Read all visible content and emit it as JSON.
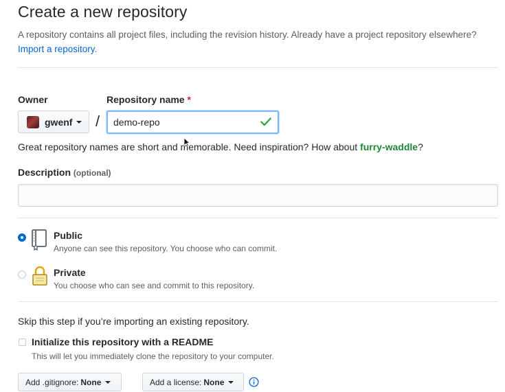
{
  "page": {
    "title": "Create a new repository",
    "intro_text": "A repository contains all project files, including the revision history. Already have a project repository elsewhere?",
    "import_link": "Import a repository",
    "intro_period": "."
  },
  "owner": {
    "label": "Owner",
    "value": "gwenf"
  },
  "repo_name": {
    "label": "Repository name",
    "required_mark": "*",
    "value": "demo-repo",
    "slash": "/"
  },
  "hint": {
    "text": "Great repository names are short and memorable. Need inspiration? How about",
    "suggestion": "furry-waddle",
    "suffix": "?"
  },
  "description": {
    "label": "Description",
    "optional": "(optional)",
    "value": ""
  },
  "visibility": {
    "selected": "public",
    "public": {
      "title": "Public",
      "note": "Anyone can see this repository. You choose who can commit."
    },
    "private": {
      "title": "Private",
      "note": "You choose who can see and commit to this repository."
    }
  },
  "init": {
    "skip_text": "Skip this step if you’re importing an existing repository.",
    "readme_label": "Initialize this repository with a README",
    "readme_note": "This will let you immediately clone the repository to your computer."
  },
  "gitignore": {
    "prefix": "Add .gitignore:",
    "value": "None"
  },
  "license": {
    "prefix": "Add a license:",
    "value": "None"
  },
  "colors": {
    "link": "#0366d6",
    "success": "#28a745",
    "suggestion": "#22863a",
    "required": "#cb2431"
  }
}
